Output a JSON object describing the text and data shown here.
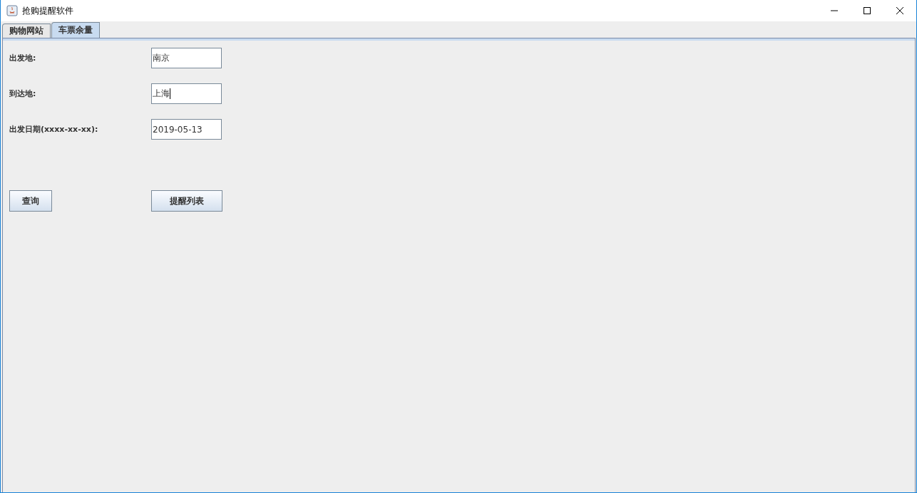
{
  "window": {
    "title": "抢购提醒软件"
  },
  "tabs": [
    {
      "label": "购物网站",
      "selected": false
    },
    {
      "label": "车票余量",
      "selected": true
    }
  ],
  "fields": [
    {
      "label": "出发地:",
      "value": "南京",
      "focused": false
    },
    {
      "label": "到达地:",
      "value": "上海",
      "focused": true
    },
    {
      "label": "出发日期(xxxx-xx-xx):",
      "value": "2019-05-13",
      "focused": false
    }
  ],
  "buttons": [
    "查询",
    "提醒列表"
  ]
}
